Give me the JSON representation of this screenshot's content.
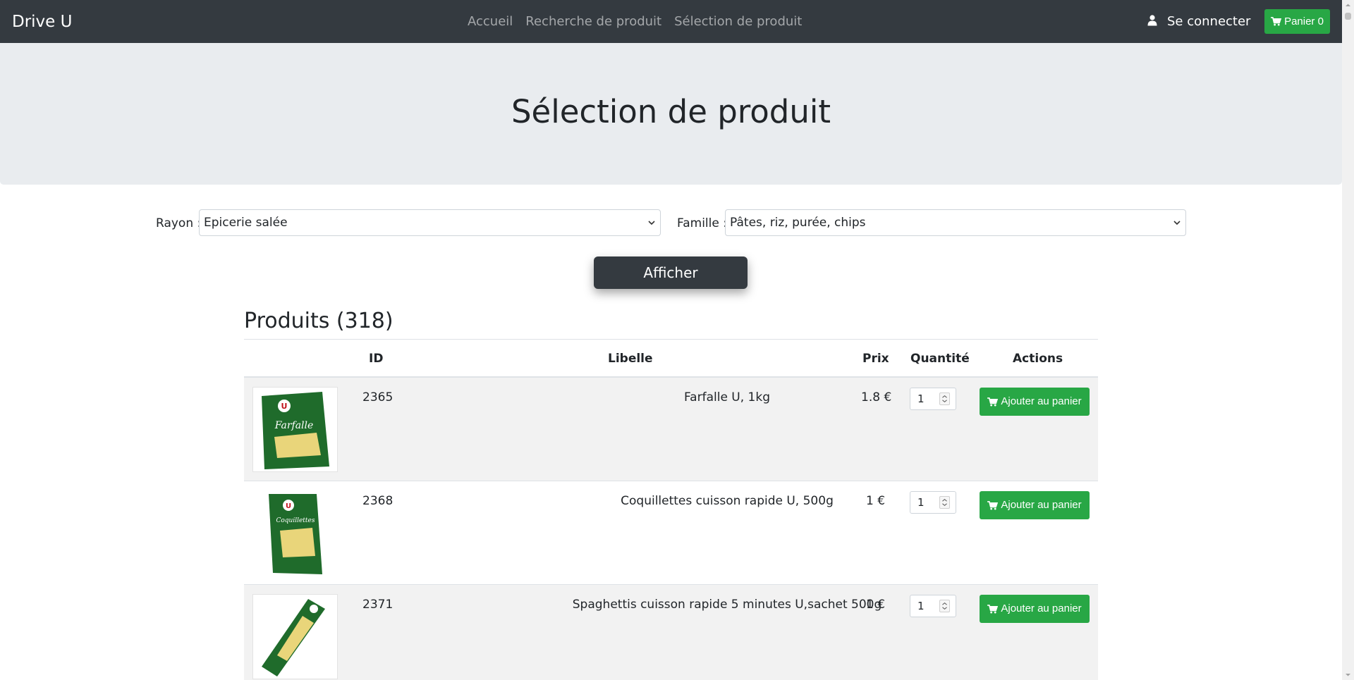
{
  "navbar": {
    "brand": "Drive U",
    "links": [
      "Accueil",
      "Recherche de produit",
      "Sélection de produit"
    ],
    "login_label": "Se connecter",
    "cart_label": "Panier 0"
  },
  "jumbotron": {
    "title": "Sélection de produit"
  },
  "filters": {
    "rayon_label": "Rayon :",
    "rayon_value": "Epicerie salée",
    "famille_label": "Famille :",
    "famille_value": "Pâtes, riz, purée, chips",
    "submit_label": "Afficher"
  },
  "products": {
    "title": "Produits (318)",
    "headers": {
      "id": "ID",
      "libelle": "Libelle",
      "prix": "Prix",
      "quantite": "Quantité",
      "actions": "Actions"
    },
    "rows": [
      {
        "id": "2365",
        "libelle": "Farfalle U, 1kg",
        "prix": "1.8 €",
        "quantite": "1",
        "action": "Ajouter au panier",
        "image": "farfalle-pack"
      },
      {
        "id": "2368",
        "libelle": "Coquillettes cuisson rapide U, 500g",
        "prix": "1 €",
        "quantite": "1",
        "action": "Ajouter au panier",
        "image": "coquillettes-pack"
      },
      {
        "id": "2371",
        "libelle": "Spaghettis cuisson rapide 5 minutes U,sachet 500g",
        "prix": "1 €",
        "quantite": "1",
        "action": "Ajouter au panier",
        "image": "spaghettis-pack"
      }
    ]
  },
  "colors": {
    "navbar": "#343a40",
    "success": "#28a745",
    "jumbotron": "#e9ecef",
    "packaging_green": "#1f6b2b"
  },
  "icons": [
    "user-icon",
    "cart-icon",
    "chevron-down-icon",
    "spinner-icon"
  ]
}
